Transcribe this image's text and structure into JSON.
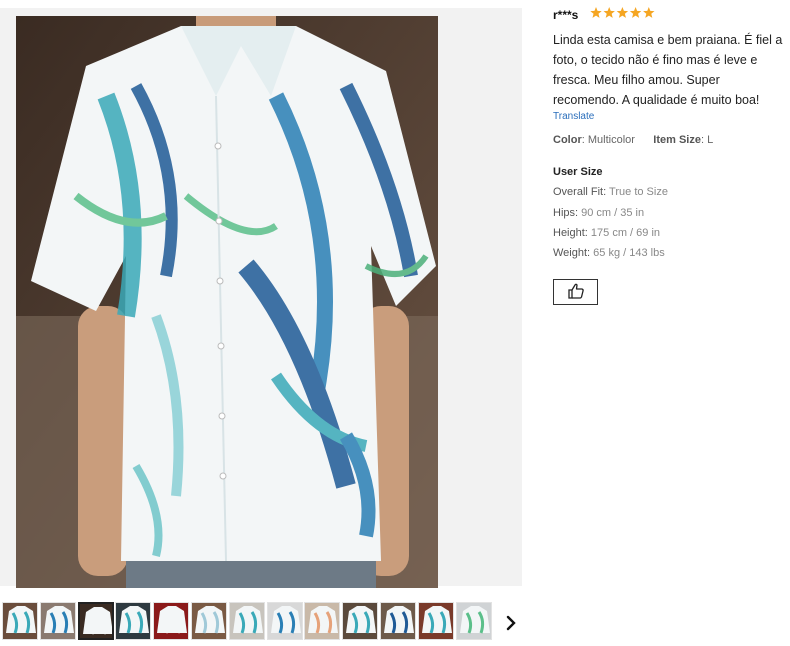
{
  "review": {
    "reviewer": "r***s",
    "rating": 5,
    "text": "Linda esta camisa e bem praiana. É fiel a foto, o tecido não é fino mas é leve e fresca. Meu filho amou. Super recomendo. A qualidade é muito boa!",
    "translate_label": "Translate",
    "color_label": "Color",
    "color_value": "Multicolor",
    "size_label": "Item Size",
    "size_value": "L"
  },
  "user_size": {
    "title": "User Size",
    "rows": [
      {
        "label": "Overall Fit",
        "value": "True to Size"
      },
      {
        "label": "Hips",
        "value": "90 cm / 35 in"
      },
      {
        "label": "Height",
        "value": "175 cm / 69 in"
      },
      {
        "label": "Weight",
        "value": "65 kg / 143 lbs"
      }
    ]
  },
  "thumbnails": {
    "count": 13,
    "selected_index": 2
  },
  "colors": {
    "star": "#f5a623",
    "link": "#2a6ebb",
    "shirt_teal": "#3aa9b8",
    "shirt_blue": "#1f5a96"
  },
  "icons": {
    "like": "thumbs-up-icon",
    "next": "chevron-right-icon",
    "star": "star-icon"
  }
}
